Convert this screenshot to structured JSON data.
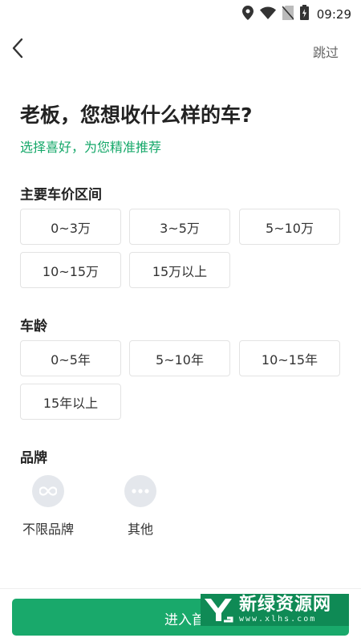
{
  "status_bar": {
    "time": "09:29",
    "icons": [
      "location-icon",
      "wifi-icon",
      "no-sim-icon",
      "battery-icon"
    ]
  },
  "nav": {
    "back_icon": "chevron-left-icon",
    "skip_label": "跳过"
  },
  "header": {
    "title": "老板，您想收什么样的车?",
    "subtitle": "选择喜好，为您精准推荐"
  },
  "price_section": {
    "label": "主要车价区间",
    "options": [
      "0~3万",
      "3~5万",
      "5~10万",
      "10~15万",
      "15万以上"
    ]
  },
  "age_section": {
    "label": "车龄",
    "options": [
      "0~5年",
      "5~10年",
      "10~15年",
      "15年以上"
    ]
  },
  "brand_section": {
    "label": "品牌",
    "items": [
      {
        "label": "不限品牌",
        "icon": "infinity-icon"
      },
      {
        "label": "其他",
        "icon": "more-dots-icon"
      }
    ]
  },
  "bottom": {
    "enter_label": "进入首页",
    "watermark_main": "新绿资源网",
    "watermark_sub": "www.xlhs.com"
  },
  "colors": {
    "accent": "#19a96b",
    "subtitle": "#16a86a",
    "option_border": "#e3e3e3",
    "brand_circle": "#e4e7ec"
  }
}
